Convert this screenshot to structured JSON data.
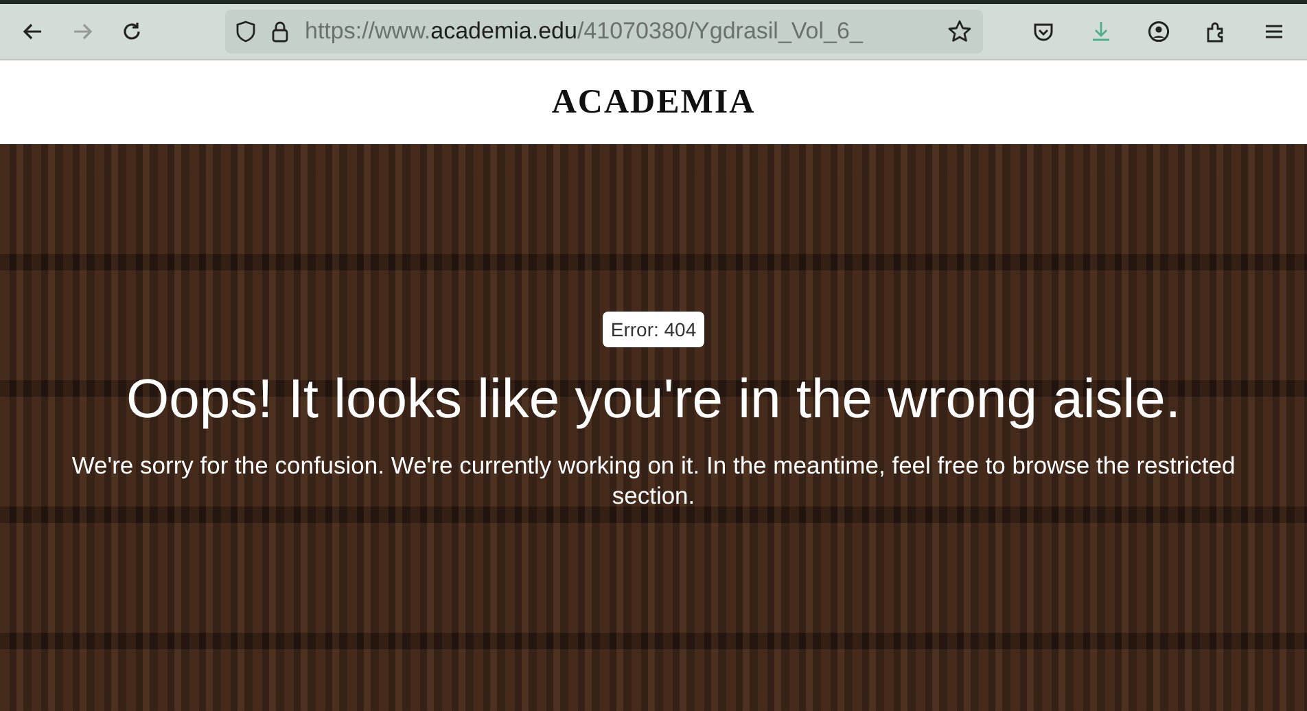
{
  "browser": {
    "url": {
      "prefix": "https://www.",
      "domain": "academia.edu",
      "path": "/41070380/Ygdrasil_Vol_6_"
    }
  },
  "header": {
    "logo": "ACADEMIA"
  },
  "hero": {
    "badge": "Error: 404",
    "heading": "Oops! It looks like you're in the wrong aisle.",
    "message": "We're sorry for the confusion. We're currently working on it. In the meantime, feel free to browse the restricted section."
  }
}
